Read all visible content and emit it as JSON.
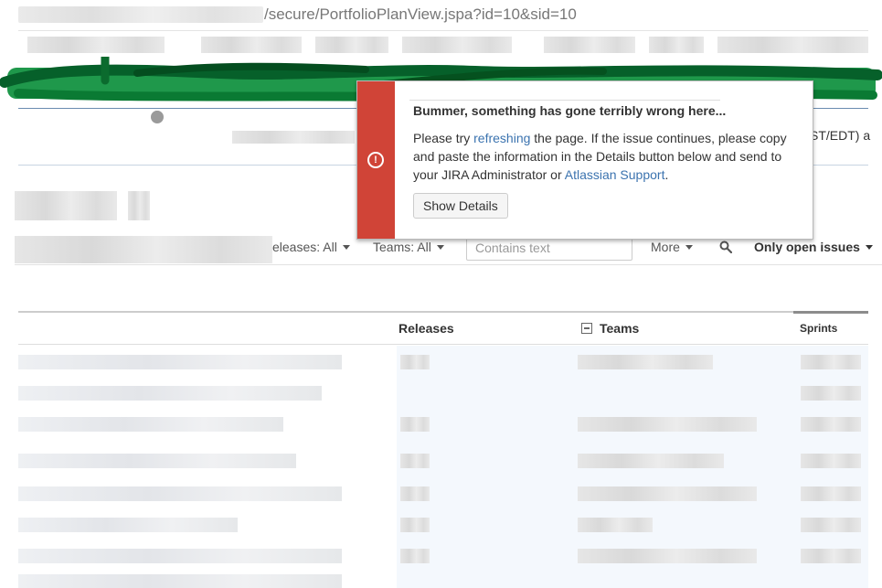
{
  "browser": {
    "url_suffix": "/secure/PortfolioPlanView.jspa?id=10&sid=10"
  },
  "header": {
    "timezone_fragment": "ST/EDT) a"
  },
  "filters": {
    "releases_label": "eleases: All",
    "teams_label": "Teams: All",
    "search_placeholder": "Contains text",
    "more_label": "More",
    "only_open_label": "Only open issues"
  },
  "table": {
    "columns": {
      "releases": "Releases",
      "teams": "Teams",
      "sprints": "Sprints"
    }
  },
  "error_dialog": {
    "title": "Bummer, something has gone terribly wrong here...",
    "message_part1": "Please try ",
    "refresh_link": "refreshing",
    "message_part2": " the page. If the issue continues, please copy and paste the information in the Details button below and send to your JIRA Administrator or ",
    "support_link": "Atlassian Support",
    "message_part3": ".",
    "show_details_label": "Show Details"
  },
  "colors": {
    "accent_link": "#3b73af",
    "error_red": "#d04437",
    "scribble_green": "#0a8a3a"
  }
}
